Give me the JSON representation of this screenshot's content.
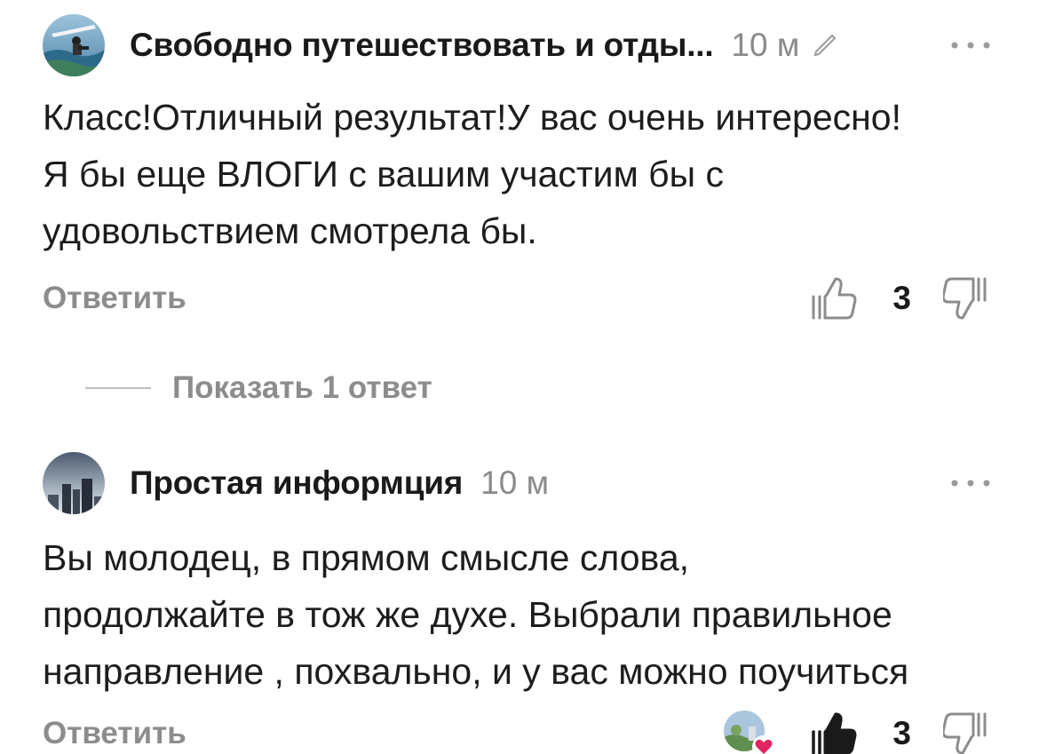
{
  "comments": [
    {
      "author": "Свободно путешествовать и отды...",
      "time": "10 м",
      "text_lines": [
        "Класс!Отличный результат!У вас очень интересно!",
        "Я бы  еще ВЛОГИ с вашим участим бы с",
        "удовольствием смотрела бы."
      ],
      "reply_label": "Ответить",
      "likes": "3",
      "show_replies_label": "Показать 1 ответ"
    },
    {
      "author": "Простая информция",
      "time": "10 м",
      "text_lines": [
        "Вы молодец, в прямом смысле слова,",
        "продолжайте в тож же духе. Выбрали правильное",
        "направление , похвально, и у вас можно поучиться"
      ],
      "reply_label": "Ответить",
      "likes": "3"
    }
  ],
  "colors": {
    "text": "#1d1d1d",
    "muted": "#8c8c8c",
    "heart": "#e0245e"
  }
}
